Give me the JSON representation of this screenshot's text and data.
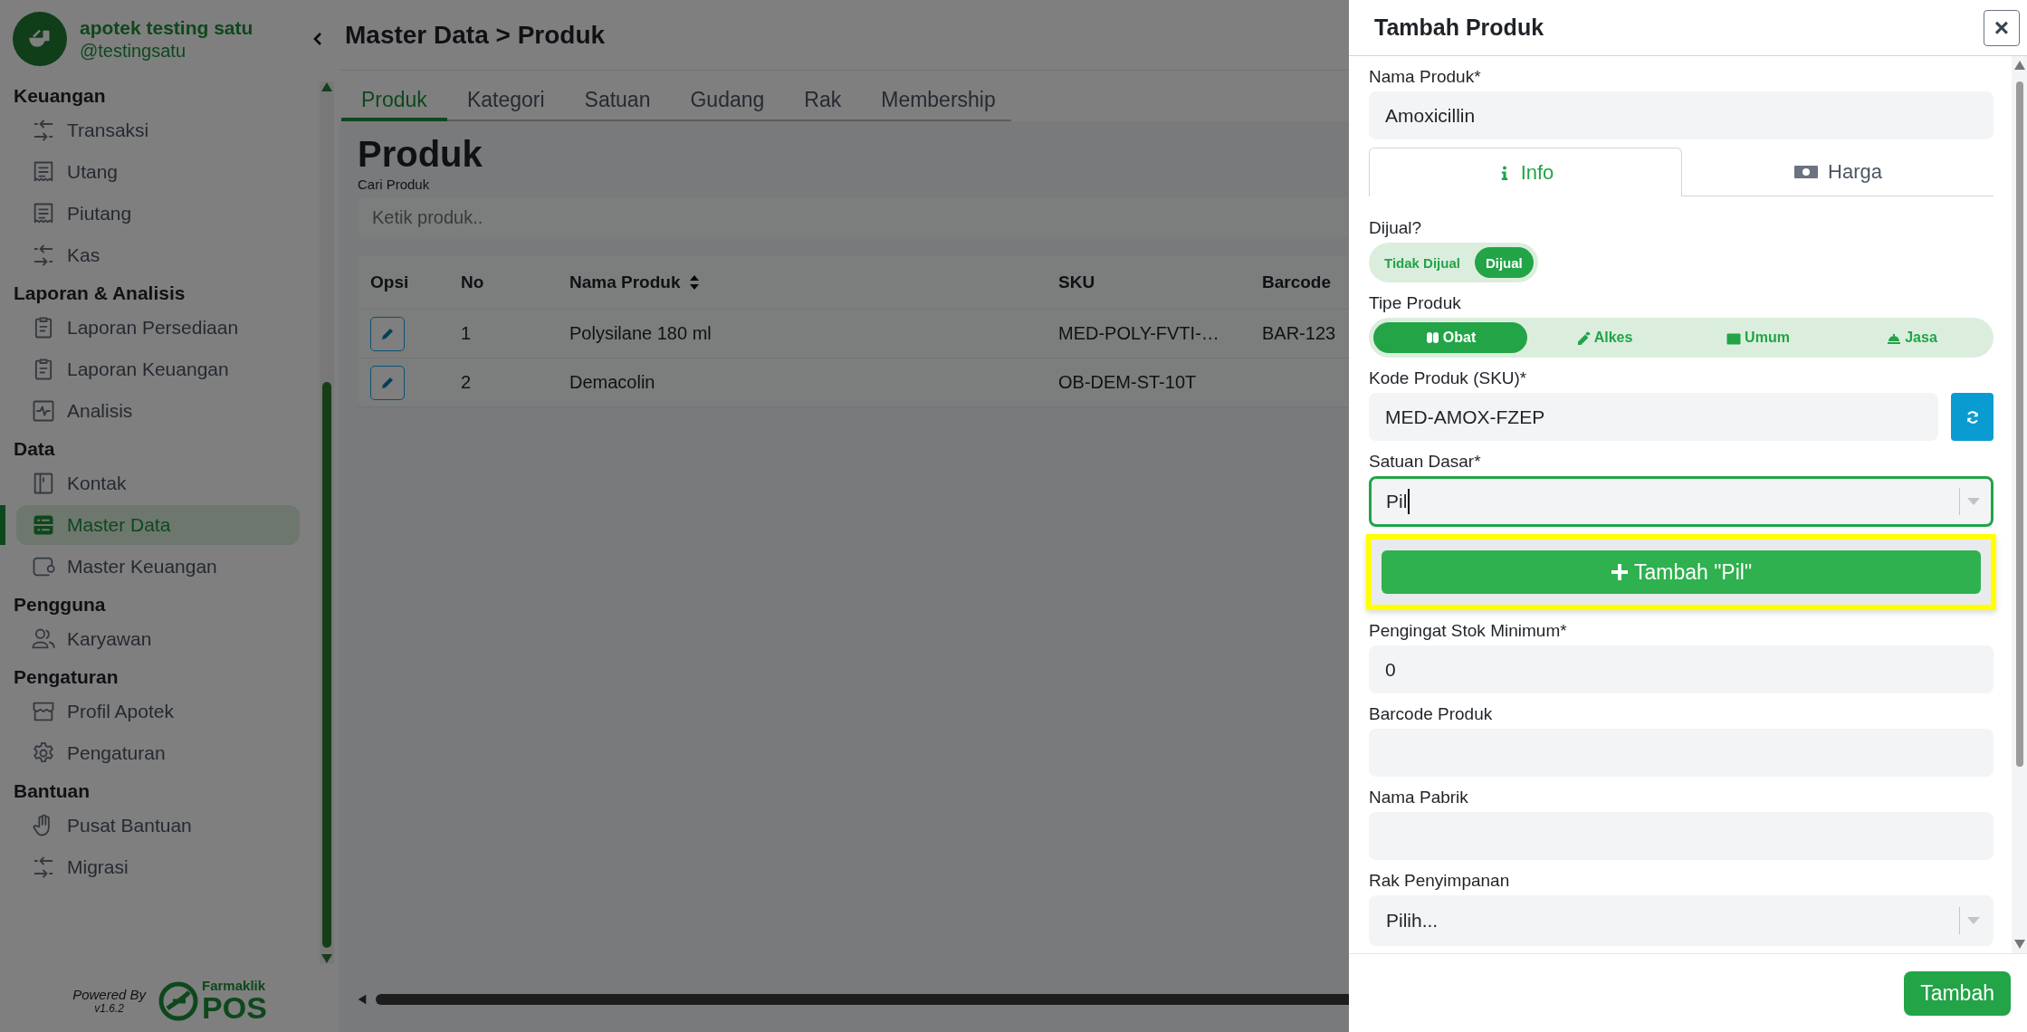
{
  "sidebar": {
    "app_name": "apotek testing satu",
    "handle": "@testingsatu",
    "sections": [
      {
        "title": "Keuangan",
        "items": [
          {
            "label": "Transaksi",
            "selected": false
          },
          {
            "label": "Utang",
            "selected": false
          },
          {
            "label": "Piutang",
            "selected": false
          },
          {
            "label": "Kas",
            "selected": false
          }
        ]
      },
      {
        "title": "Laporan & Analisis",
        "items": [
          {
            "label": "Laporan Persediaan",
            "selected": false
          },
          {
            "label": "Laporan Keuangan",
            "selected": false
          },
          {
            "label": "Analisis",
            "selected": false
          }
        ]
      },
      {
        "title": "Data",
        "items": [
          {
            "label": "Kontak",
            "selected": false
          },
          {
            "label": "Master Data",
            "selected": true
          },
          {
            "label": "Master Keuangan",
            "selected": false
          }
        ]
      },
      {
        "title": "Pengguna",
        "items": [
          {
            "label": "Karyawan",
            "selected": false
          }
        ]
      },
      {
        "title": "Pengaturan",
        "items": [
          {
            "label": "Profil Apotek",
            "selected": false
          },
          {
            "label": "Pengaturan",
            "selected": false
          }
        ]
      },
      {
        "title": "Bantuan",
        "items": [
          {
            "label": "Pusat Bantuan",
            "selected": false
          },
          {
            "label": "Migrasi",
            "selected": false
          }
        ]
      }
    ],
    "powered_by": "Powered By",
    "version": "v1.6.2",
    "brand_top": "Farmaklik",
    "brand_bottom": "POS"
  },
  "header": {
    "breadcrumb": "Master Data > Produk"
  },
  "tabs": [
    {
      "label": "Produk",
      "selected": true
    },
    {
      "label": "Kategori",
      "selected": false
    },
    {
      "label": "Satuan",
      "selected": false
    },
    {
      "label": "Gudang",
      "selected": false
    },
    {
      "label": "Rak",
      "selected": false
    },
    {
      "label": "Membership",
      "selected": false
    }
  ],
  "page": {
    "title": "Produk",
    "search_label": "Cari Produk",
    "search_placeholder": "Ketik produk..",
    "table": {
      "columns": [
        "Opsi",
        "No",
        "Nama Produk",
        "SKU",
        "Barcode"
      ],
      "rows": [
        {
          "no": "1",
          "name": "Polysilane 180 ml",
          "sku": "MED-POLY-FVTI-…",
          "barcode": "BAR-123"
        },
        {
          "no": "2",
          "name": "Demacolin",
          "sku": "OB-DEM-ST-10T"
        }
      ]
    }
  },
  "drawer": {
    "title": "Tambah Produk",
    "close": "×",
    "name_field": {
      "label": "Nama Produk*",
      "value": "Amoxicillin"
    },
    "tabs": [
      {
        "label": "Info",
        "selected": true
      },
      {
        "label": "Harga",
        "selected": false
      }
    ],
    "fields": [
      {
        "kind": "toggle",
        "label": "Dijual?",
        "options": [
          {
            "label": "Tidak Dijual",
            "selected": false
          },
          {
            "label": "Dijual",
            "selected": true
          }
        ]
      },
      {
        "kind": "segmented",
        "label": "Tipe Produk",
        "options": [
          {
            "label": "Obat",
            "selected": true
          },
          {
            "label": "Alkes",
            "selected": false
          },
          {
            "label": "Umum",
            "selected": false
          },
          {
            "label": "Jasa",
            "selected": false
          }
        ]
      },
      {
        "kind": "sku",
        "label": "Kode Produk (SKU)*",
        "value": "MED-AMOX-FZEP"
      },
      {
        "kind": "combo",
        "label": "Satuan Dasar*",
        "value": "Pil",
        "focused": true,
        "menu_option": "Tambah \"Pil\""
      },
      {
        "kind": "text",
        "label": "Pengingat Stok Minimum*",
        "value": "0"
      },
      {
        "kind": "text",
        "label": "Barcode Produk"
      },
      {
        "kind": "text",
        "label": "Nama Pabrik"
      },
      {
        "kind": "select",
        "label": "Rak Penyimpanan",
        "placeholder": "Pilih..."
      }
    ],
    "submit": "Tambah"
  }
}
